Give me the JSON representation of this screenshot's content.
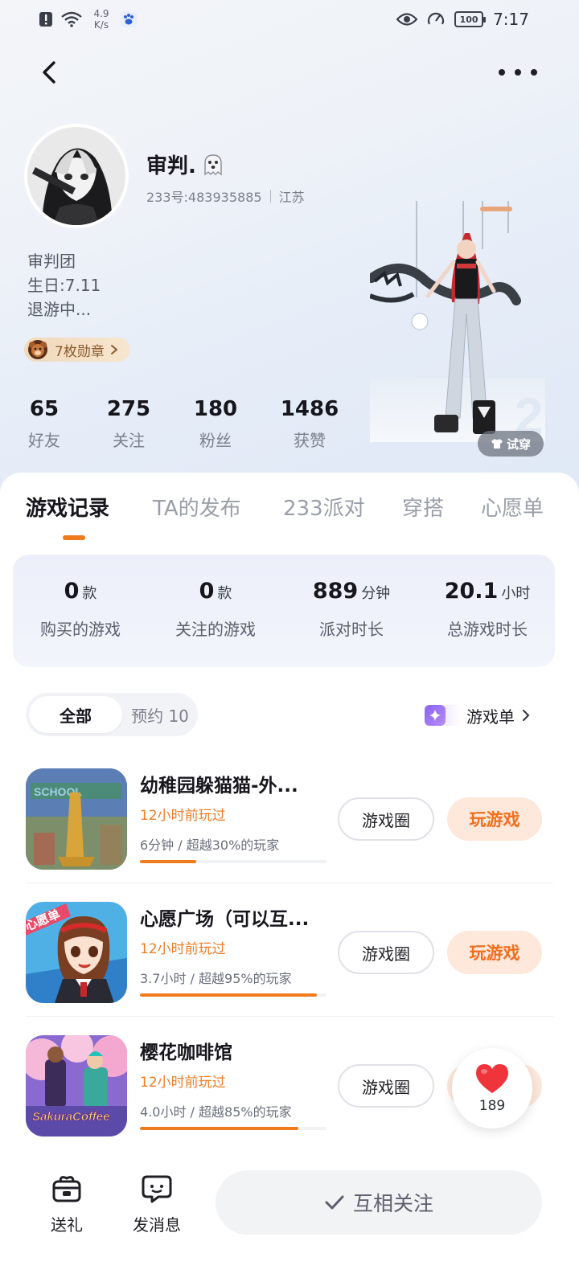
{
  "status_bar": {
    "net_speed_value": "4.9",
    "net_speed_unit": "K/s",
    "battery": "100",
    "time": "7:17"
  },
  "profile": {
    "nickname": "审判.",
    "uid": "233号:483935885",
    "location": "江苏",
    "bio_lines": [
      "审判团",
      "生日:7.11",
      "退游中..."
    ],
    "badge_label": "7枚勋章",
    "try_on_label": "试穿"
  },
  "stats": [
    {
      "value": "65",
      "label": "好友"
    },
    {
      "value": "275",
      "label": "关注"
    },
    {
      "value": "180",
      "label": "粉丝"
    },
    {
      "value": "1486",
      "label": "获赞"
    }
  ],
  "tabs": [
    {
      "label": "游戏记录",
      "active": true
    },
    {
      "label": "TA的发布",
      "active": false
    },
    {
      "label": "233派对",
      "active": false
    },
    {
      "label": "穿搭",
      "active": false
    },
    {
      "label": "心愿单",
      "active": false
    }
  ],
  "summary": [
    {
      "value": "0",
      "unit": "款",
      "label": "购买的游戏"
    },
    {
      "value": "0",
      "unit": "款",
      "label": "关注的游戏"
    },
    {
      "value": "889",
      "unit": "分钟",
      "label": "派对时长"
    },
    {
      "value": "20.1",
      "unit": "小时",
      "label": "总游戏时长"
    }
  ],
  "filter": {
    "all_label": "全部",
    "reserve_label": "预约 10"
  },
  "game_list_link": "游戏单",
  "games": [
    {
      "name": "幼稚园躲猫猫-外...",
      "recent": "12小时前玩过",
      "stats": "6分钟 / 超越30%的玩家",
      "progress": 0.3,
      "circle_label": "游戏圈",
      "play_label": "玩游戏"
    },
    {
      "name": "心愿广场（可以互...",
      "recent": "12小时前玩过",
      "stats": "3.7小时 / 超越95%的玩家",
      "progress": 0.95,
      "circle_label": "游戏圈",
      "play_label": "玩游戏"
    },
    {
      "name": "樱花咖啡馆",
      "recent": "12小时前玩过",
      "stats": "4.0小时 / 超越85%的玩家",
      "progress": 0.85,
      "circle_label": "游戏圈",
      "play_label": ""
    }
  ],
  "thumb_texts": {
    "game1": "SCHOOL",
    "game2": "心愿单",
    "game3": "SakuraCoffee"
  },
  "like_count": "189",
  "bottom_bar": {
    "gift_label": "送礼",
    "message_label": "发消息",
    "follow_label": "互相关注"
  },
  "colors": {
    "accent": "#f07b1c",
    "play_bg": "#fde8db",
    "like_red": "#f0343c"
  },
  "icons": {
    "back": "chevron-left-icon",
    "more": "more-dots-icon",
    "gift": "gift-box-icon",
    "message": "chat-bubble-icon",
    "follow_check": "check-icon",
    "like": "heart-icon",
    "badge_medal": "bear-medal-icon"
  }
}
